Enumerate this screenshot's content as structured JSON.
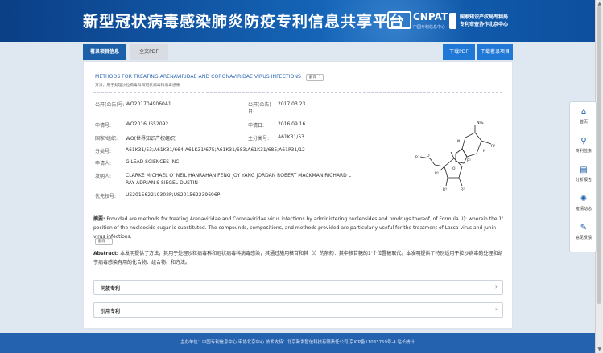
{
  "header": {
    "title": "新型冠状病毒感染肺炎防疫专利信息共享平台",
    "logo_mark": "i",
    "logo_name": "CNPAT",
    "logo_sub": "中国专利信息中心",
    "org_line1": "国家知识产权局专利局",
    "org_line2": "专利审查协作北京中心"
  },
  "tabs": [
    "著录项目信息",
    "全文PDF"
  ],
  "download": {
    "pdf": "下载PDF",
    "record": "下载著录项目"
  },
  "patent": {
    "title": "METHODS FOR TREATING ARENAVIRIDAE AND CORONAVIRIDAE VIRUS INFECTIONS",
    "translate": "翻译",
    "subtitle": "方法，用于处理沙粒病毒科和冠状病毒科病毒感染",
    "fields": [
      {
        "label": "公开(公告)号:",
        "value": "WO2017049060A1"
      },
      {
        "label": "公开(公告)日:",
        "value": "2017.03.23"
      },
      {
        "label": "申请号:",
        "value": "WO2016US52092"
      },
      {
        "label": "申请日:",
        "value": "2016.09.16"
      },
      {
        "label": "国家/组织:",
        "value": "WO(世界知识产权组织)"
      },
      {
        "label": "主分类号:",
        "value": "A61K31/53"
      },
      {
        "label": "分类号:",
        "value": "A61K31/53;A61K31/664;A61K31/675;A61K31/683;A61K31/685;A61P31/12"
      },
      {
        "label": "申请人:",
        "value": "GILEAD SCIENCES INC"
      },
      {
        "label": "发明人:",
        "value_line1": "CLARKE MICHAEL O' NEIL HANRAHAN  FENG JOY YANG  JORDAN ROBERT  MACKMAN RICHARD L",
        "value_line2": "RAY ADRIAN S  SIEGEL DUSTIN"
      },
      {
        "label": "优先权号:",
        "value": "US201562219302P;US201562239696P"
      }
    ],
    "abstract_label": "摘要:",
    "abstract": "Provided are methods for treating Arenaviridae and Coronaviridae virus infections by administering nucleosides and prodrugs thereof, of Formula (I): wherein the 1' position of the nucleoside sugar is substituted. The compounds, compositions, and methods provided are particularly useful for the treatment of Lassa virus and Junin virus infections.",
    "collapse": "翻译",
    "abstract_cn_label": "Abstract:",
    "abstract_cn": "本发明提供了方法，其用于处理沙粒病毒科和冠状病毒科病毒感染，其通过施用核苷和其（I）的前药：其中核苷糖的1'个位置被取代。本发明提供了特别适用于拉沙病毒的处理和胡宁病毒感染有用的化合物、组合物、和方法。",
    "cited": "同族专利",
    "citing": "引用专利"
  },
  "footer": "主办单位：中国专利信息中心  审协北京中心  技术支持：北京新发智信科技有限责任公司  京ICP备11033759号-4  站长统计",
  "side": [
    "首页",
    "专利检索",
    "分析报告",
    "疫情动态",
    "意见反馈"
  ]
}
